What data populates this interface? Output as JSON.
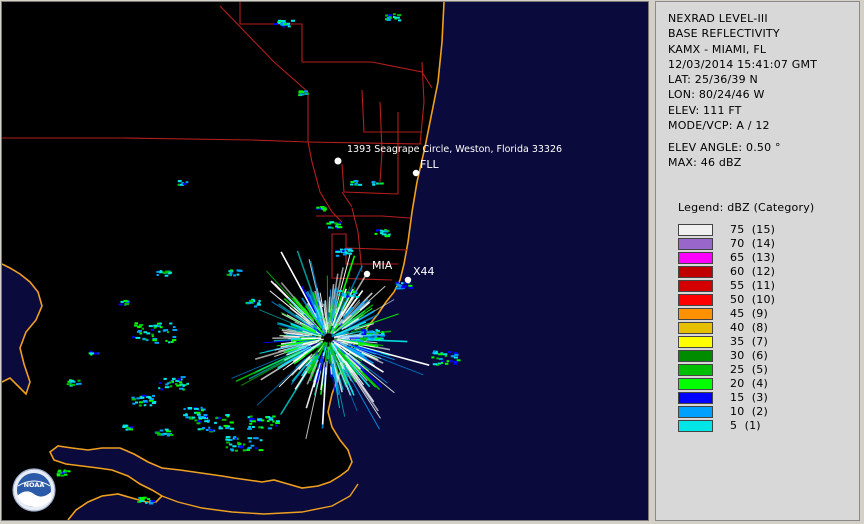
{
  "product": {
    "line1": "NEXRAD LEVEL-III",
    "line2": "BASE REFLECTIVITY",
    "station": "KAMX - MIAMI, FL",
    "datetime": "12/03/2014 15:41:07 GMT",
    "lat": "LAT: 25/36/39 N",
    "lon": "LON: 80/24/46 W",
    "elev": "ELEV: 111 FT",
    "mode": "MODE/VCP: A / 12",
    "elev_angle": "ELEV ANGLE: 0.50 °",
    "max": "MAX: 46 dBZ"
  },
  "legend": {
    "title": "Legend: dBZ (Category)",
    "entries": [
      {
        "label": "75  (15)",
        "color": "#f0f0f0"
      },
      {
        "label": "70  (14)",
        "color": "#9966cc"
      },
      {
        "label": "65  (13)",
        "color": "#ff00ff"
      },
      {
        "label": "60  (12)",
        "color": "#c00000"
      },
      {
        "label": "55  (11)",
        "color": "#d40000"
      },
      {
        "label": "50  (10)",
        "color": "#ff0000"
      },
      {
        "label": "45  (9)",
        "color": "#ff9000"
      },
      {
        "label": "40  (8)",
        "color": "#e6c000"
      },
      {
        "label": "35  (7)",
        "color": "#ffff00"
      },
      {
        "label": "30  (6)",
        "color": "#008c00"
      },
      {
        "label": "25  (5)",
        "color": "#00bf00"
      },
      {
        "label": "20  (4)",
        "color": "#00ff00"
      },
      {
        "label": "15  (3)",
        "color": "#0000ff"
      },
      {
        "label": "10  (2)",
        "color": "#00a0ff"
      },
      {
        "label": "5  (1)",
        "color": "#00e6e6"
      }
    ]
  },
  "map": {
    "location_label": "1393 Seagrape Circle, Weston, Florida 33326",
    "city_labels": [
      "FLL",
      "MIA",
      "X44"
    ],
    "logo_text": "NOAA",
    "colors": {
      "ocean": "#0a0a3c",
      "land": "#000000",
      "coast": "#f0a020",
      "county": "#b41e1e"
    }
  }
}
